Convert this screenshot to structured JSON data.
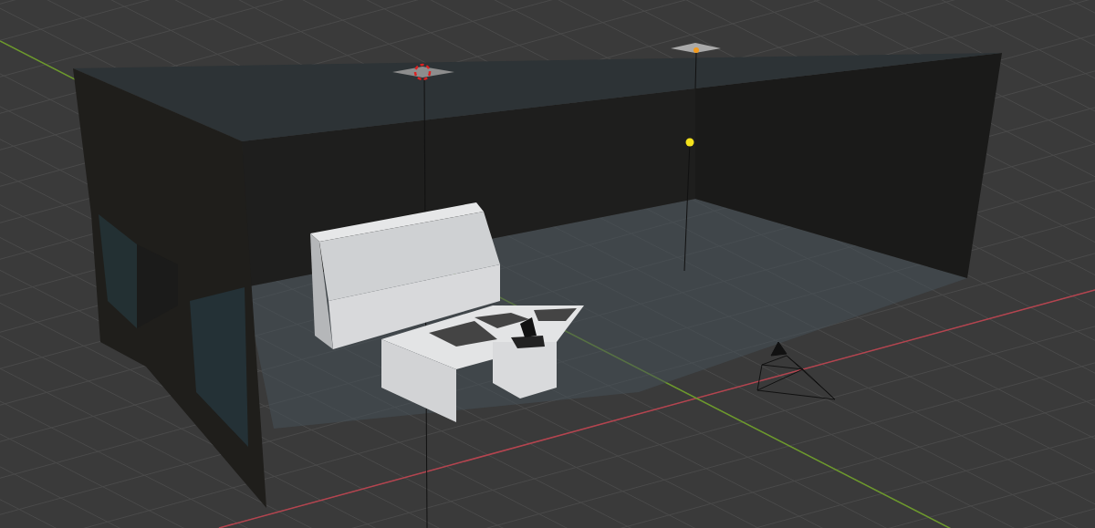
{
  "viewport": {
    "objects": [
      {
        "kind": "room"
      },
      {
        "kind": "console"
      },
      {
        "kind": "desk"
      },
      {
        "kind": "point-light"
      },
      {
        "kind": "sun-light"
      },
      {
        "kind": "camera"
      },
      {
        "kind": "cursor"
      }
    ]
  }
}
